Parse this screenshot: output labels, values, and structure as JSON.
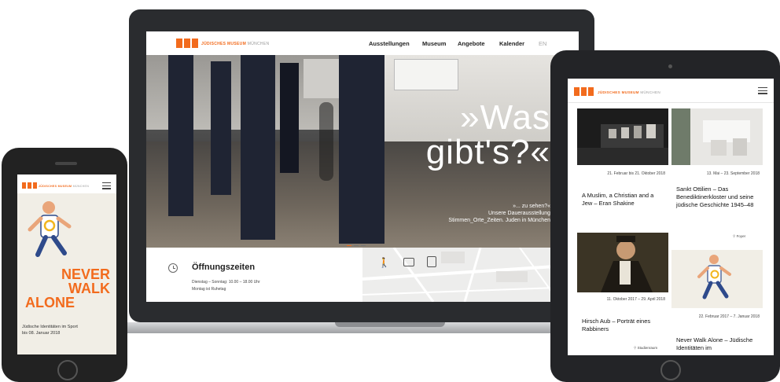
{
  "brand": {
    "name": "JÜDISCHES MUSEUM",
    "city": "MÜNCHEN",
    "accent": "#f26b1d"
  },
  "desktop": {
    "nav": [
      "Ausstellungen",
      "Museum",
      "Angebote",
      "Kalender",
      "EN"
    ],
    "hero": {
      "title_line1": "»Was",
      "title_line2": "gibt's?«",
      "sub_line1": "»... zu sehen?«",
      "sub_line2": "Unsere Dauerausstellung",
      "sub_line3": "Stimmen_Orte_Zeiten. Juden in München"
    },
    "hours": {
      "title": "Öffnungszeiten",
      "line1": "Dienstag – Sonntag: 10.00 – 18.00 Uhr",
      "line2": "Montag ist Ruhetag",
      "icon": "clock-icon"
    },
    "map_icons": [
      "walk-icon",
      "car-icon",
      "tram-icon"
    ]
  },
  "phone": {
    "title_line1": "NEVER",
    "title_line2": "WALK",
    "title_line3": "ALONE",
    "sub_line1": "Jüdische Identitäten im Sport",
    "sub_line2": "bis 08. Januar 2018"
  },
  "tablet": {
    "cards": [
      {
        "date": "21. Februar bis 21. Oktober 2018",
        "title": "A Muslim, a Christian and a Jew – Eran Shakine",
        "place": ""
      },
      {
        "date": "13. Mai – 23. September 2018",
        "title": "Sankt Ottilien – Das Benediktinerkloster und seine jüdische Geschichte 1945–48",
        "place": "Foyer"
      },
      {
        "date": "11. Oktober 2017 – 29. April 2018",
        "title": "Hirsch Aub – Porträt eines Rabbiners",
        "place": "Studienraum"
      },
      {
        "date": "22. Februar 2017 – 7. Januar 2018",
        "title": "Never Walk Alone – Jüdische Identitäten im",
        "place": ""
      }
    ]
  }
}
